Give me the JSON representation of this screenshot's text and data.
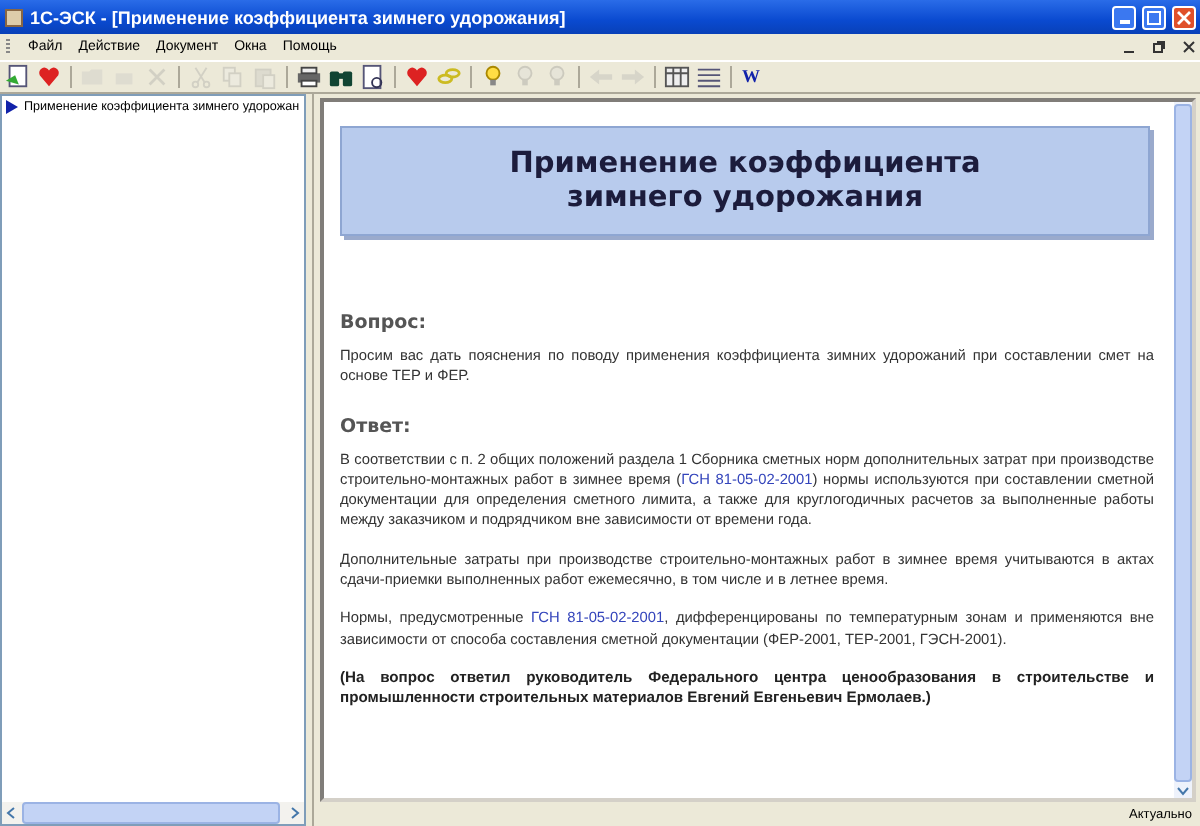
{
  "window": {
    "title": "1С-ЭСК - [Применение коэффициента зимнего удорожания]"
  },
  "menu": [
    "Файл",
    "Действие",
    "Документ",
    "Окна",
    "Помощь"
  ],
  "toolbar": [
    {
      "kind": "page",
      "disabled": false
    },
    {
      "kind": "heart",
      "disabled": false
    },
    {
      "kind": "separator"
    },
    {
      "kind": "folder",
      "disabled": true
    },
    {
      "kind": "box",
      "disabled": true
    },
    {
      "kind": "cross",
      "disabled": true
    },
    {
      "kind": "separator"
    },
    {
      "kind": "scissors",
      "disabled": true
    },
    {
      "kind": "copy",
      "disabled": true
    },
    {
      "kind": "paste",
      "disabled": true
    },
    {
      "kind": "separator"
    },
    {
      "kind": "printer",
      "disabled": false
    },
    {
      "kind": "binoculars",
      "disabled": false
    },
    {
      "kind": "preview",
      "disabled": false
    },
    {
      "kind": "separator"
    },
    {
      "kind": "heart",
      "disabled": false
    },
    {
      "kind": "link",
      "disabled": false
    },
    {
      "kind": "separator"
    },
    {
      "kind": "bulb",
      "disabled": false
    },
    {
      "kind": "bulb",
      "disabled": true
    },
    {
      "kind": "bulb",
      "disabled": true
    },
    {
      "kind": "separator"
    },
    {
      "kind": "back",
      "disabled": true
    },
    {
      "kind": "forward",
      "disabled": true
    },
    {
      "kind": "separator"
    },
    {
      "kind": "columns",
      "disabled": false
    },
    {
      "kind": "list",
      "disabled": false
    },
    {
      "kind": "separator"
    },
    {
      "kind": "word",
      "disabled": false,
      "label": "W"
    }
  ],
  "tree": {
    "items": [
      {
        "label": "Применение коэффициента зимнего удорожан"
      }
    ]
  },
  "document": {
    "title": "Применение коэффициента зимнего удорожания",
    "sections": [
      {
        "heading": "Вопрос:",
        "paragraphs": [
          {
            "bold": false,
            "parts": [
              {
                "kind": "text",
                "text": "Просим вас дать пояснения по поводу применения коэффициента зимних удорожаний при составлении смет на основе ТЕР и ФЕР."
              }
            ]
          }
        ]
      },
      {
        "heading": "Ответ:",
        "paragraphs": [
          {
            "bold": false,
            "parts": [
              {
                "kind": "text",
                "text": "В соответствии с п. 2 общих положений раздела 1 Сборника сметных норм дополнительных затрат при производстве строительно-монтажных работ в зимнее время ("
              },
              {
                "kind": "link",
                "text": "ГСН 81-05-02-2001"
              },
              {
                "kind": "text",
                "text": ") нормы используются при составлении сметной документации для определения сметного лимита, а также для круглогодичных расчетов за выполненные работы между заказчиком и подрядчиком вне зависимости от времени года."
              }
            ]
          },
          {
            "bold": false,
            "parts": [
              {
                "kind": "text",
                "text": "Дополнительные затраты при производстве строительно-монтажных работ в зимнее время учитываются в актах сдачи-приемки выполненных работ ежемесячно, в том числе и в летнее время."
              }
            ]
          },
          {
            "bold": false,
            "parts": [
              {
                "kind": "text",
                "text": "Нормы, предусмотренные "
              },
              {
                "kind": "link",
                "text": "ГСН 81-05-02-2001"
              },
              {
                "kind": "text",
                "text": ", дифференцированы по температурным зонам и применяются вне зависимости от способа составления сметной документации (ФЕР-2001, ТЕР-2001, ГЭСН-2001)."
              }
            ]
          },
          {
            "bold": true,
            "parts": [
              {
                "kind": "text",
                "text": "(На вопрос ответил руководитель Федерального центра ценообразования в строительстве и промышленности строительных материалов Евгений Евгеньевич Ермолаев.)"
              }
            ]
          }
        ]
      }
    ]
  },
  "status_bar": {
    "text": "Актуально"
  }
}
